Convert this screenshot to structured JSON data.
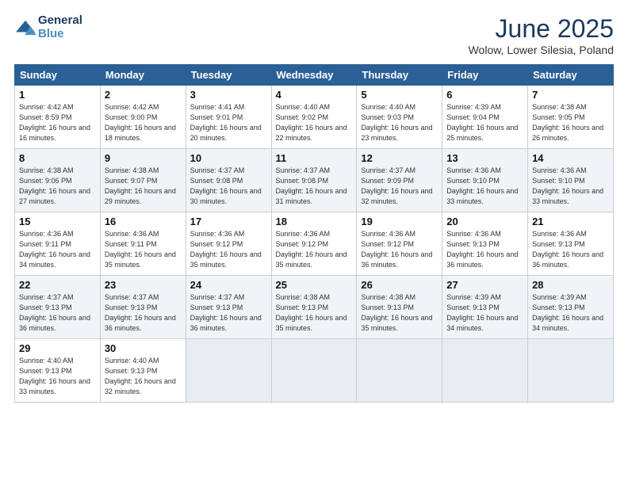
{
  "header": {
    "logo_line1": "General",
    "logo_line2": "Blue",
    "title": "June 2025",
    "subtitle": "Wolow, Lower Silesia, Poland"
  },
  "weekdays": [
    "Sunday",
    "Monday",
    "Tuesday",
    "Wednesday",
    "Thursday",
    "Friday",
    "Saturday"
  ],
  "weeks": [
    [
      {
        "day": "1",
        "sunrise": "4:42 AM",
        "sunset": "8:59 PM",
        "daylight": "16 hours and 16 minutes."
      },
      {
        "day": "2",
        "sunrise": "4:42 AM",
        "sunset": "9:00 PM",
        "daylight": "16 hours and 18 minutes."
      },
      {
        "day": "3",
        "sunrise": "4:41 AM",
        "sunset": "9:01 PM",
        "daylight": "16 hours and 20 minutes."
      },
      {
        "day": "4",
        "sunrise": "4:40 AM",
        "sunset": "9:02 PM",
        "daylight": "16 hours and 22 minutes."
      },
      {
        "day": "5",
        "sunrise": "4:40 AM",
        "sunset": "9:03 PM",
        "daylight": "16 hours and 23 minutes."
      },
      {
        "day": "6",
        "sunrise": "4:39 AM",
        "sunset": "9:04 PM",
        "daylight": "16 hours and 25 minutes."
      },
      {
        "day": "7",
        "sunrise": "4:38 AM",
        "sunset": "9:05 PM",
        "daylight": "16 hours and 26 minutes."
      }
    ],
    [
      {
        "day": "8",
        "sunrise": "4:38 AM",
        "sunset": "9:06 PM",
        "daylight": "16 hours and 27 minutes."
      },
      {
        "day": "9",
        "sunrise": "4:38 AM",
        "sunset": "9:07 PM",
        "daylight": "16 hours and 29 minutes."
      },
      {
        "day": "10",
        "sunrise": "4:37 AM",
        "sunset": "9:08 PM",
        "daylight": "16 hours and 30 minutes."
      },
      {
        "day": "11",
        "sunrise": "4:37 AM",
        "sunset": "9:08 PM",
        "daylight": "16 hours and 31 minutes."
      },
      {
        "day": "12",
        "sunrise": "4:37 AM",
        "sunset": "9:09 PM",
        "daylight": "16 hours and 32 minutes."
      },
      {
        "day": "13",
        "sunrise": "4:36 AM",
        "sunset": "9:10 PM",
        "daylight": "16 hours and 33 minutes."
      },
      {
        "day": "14",
        "sunrise": "4:36 AM",
        "sunset": "9:10 PM",
        "daylight": "16 hours and 33 minutes."
      }
    ],
    [
      {
        "day": "15",
        "sunrise": "4:36 AM",
        "sunset": "9:11 PM",
        "daylight": "16 hours and 34 minutes."
      },
      {
        "day": "16",
        "sunrise": "4:36 AM",
        "sunset": "9:11 PM",
        "daylight": "16 hours and 35 minutes."
      },
      {
        "day": "17",
        "sunrise": "4:36 AM",
        "sunset": "9:12 PM",
        "daylight": "16 hours and 35 minutes."
      },
      {
        "day": "18",
        "sunrise": "4:36 AM",
        "sunset": "9:12 PM",
        "daylight": "16 hours and 35 minutes."
      },
      {
        "day": "19",
        "sunrise": "4:36 AM",
        "sunset": "9:12 PM",
        "daylight": "16 hours and 36 minutes."
      },
      {
        "day": "20",
        "sunrise": "4:36 AM",
        "sunset": "9:13 PM",
        "daylight": "16 hours and 36 minutes."
      },
      {
        "day": "21",
        "sunrise": "4:36 AM",
        "sunset": "9:13 PM",
        "daylight": "16 hours and 36 minutes."
      }
    ],
    [
      {
        "day": "22",
        "sunrise": "4:37 AM",
        "sunset": "9:13 PM",
        "daylight": "16 hours and 36 minutes."
      },
      {
        "day": "23",
        "sunrise": "4:37 AM",
        "sunset": "9:13 PM",
        "daylight": "16 hours and 36 minutes."
      },
      {
        "day": "24",
        "sunrise": "4:37 AM",
        "sunset": "9:13 PM",
        "daylight": "16 hours and 36 minutes."
      },
      {
        "day": "25",
        "sunrise": "4:38 AM",
        "sunset": "9:13 PM",
        "daylight": "16 hours and 35 minutes."
      },
      {
        "day": "26",
        "sunrise": "4:38 AM",
        "sunset": "9:13 PM",
        "daylight": "16 hours and 35 minutes."
      },
      {
        "day": "27",
        "sunrise": "4:39 AM",
        "sunset": "9:13 PM",
        "daylight": "16 hours and 34 minutes."
      },
      {
        "day": "28",
        "sunrise": "4:39 AM",
        "sunset": "9:13 PM",
        "daylight": "16 hours and 34 minutes."
      }
    ],
    [
      {
        "day": "29",
        "sunrise": "4:40 AM",
        "sunset": "9:13 PM",
        "daylight": "16 hours and 33 minutes."
      },
      {
        "day": "30",
        "sunrise": "4:40 AM",
        "sunset": "9:13 PM",
        "daylight": "16 hours and 32 minutes."
      },
      null,
      null,
      null,
      null,
      null
    ]
  ]
}
